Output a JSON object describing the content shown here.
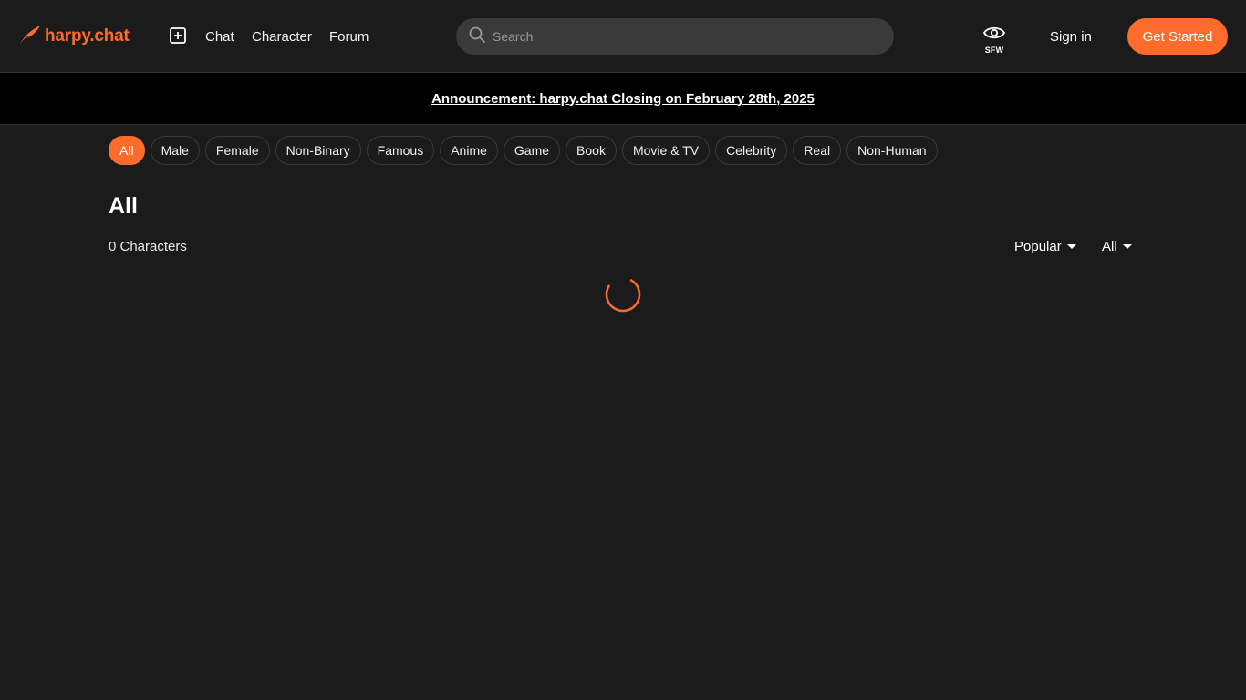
{
  "header": {
    "logo_text": "harpy.chat",
    "nav": {
      "chat": "Chat",
      "character": "Character",
      "forum": "Forum"
    },
    "search_placeholder": "Search",
    "sfw_label": "SFW",
    "sign_in": "Sign in",
    "get_started": "Get Started"
  },
  "announcement": "Announcement: harpy.chat Closing on February 28th, 2025",
  "categories": [
    "All",
    "Male",
    "Female",
    "Non-Binary",
    "Famous",
    "Anime",
    "Game",
    "Book",
    "Movie & TV",
    "Celebrity",
    "Real",
    "Non-Human"
  ],
  "active_category": "All",
  "main": {
    "title": "All",
    "count_label": "0 Characters",
    "sort_label": "Popular",
    "filter_label": "All"
  },
  "colors": {
    "accent": "#ff6b2b",
    "background": "#1b1b1b",
    "banner": "#000000"
  },
  "icons": {
    "logo": "feather-icon",
    "create": "plus-square-icon",
    "search": "search-icon",
    "sfw": "eye-icon",
    "loading": "spinner-icon"
  }
}
